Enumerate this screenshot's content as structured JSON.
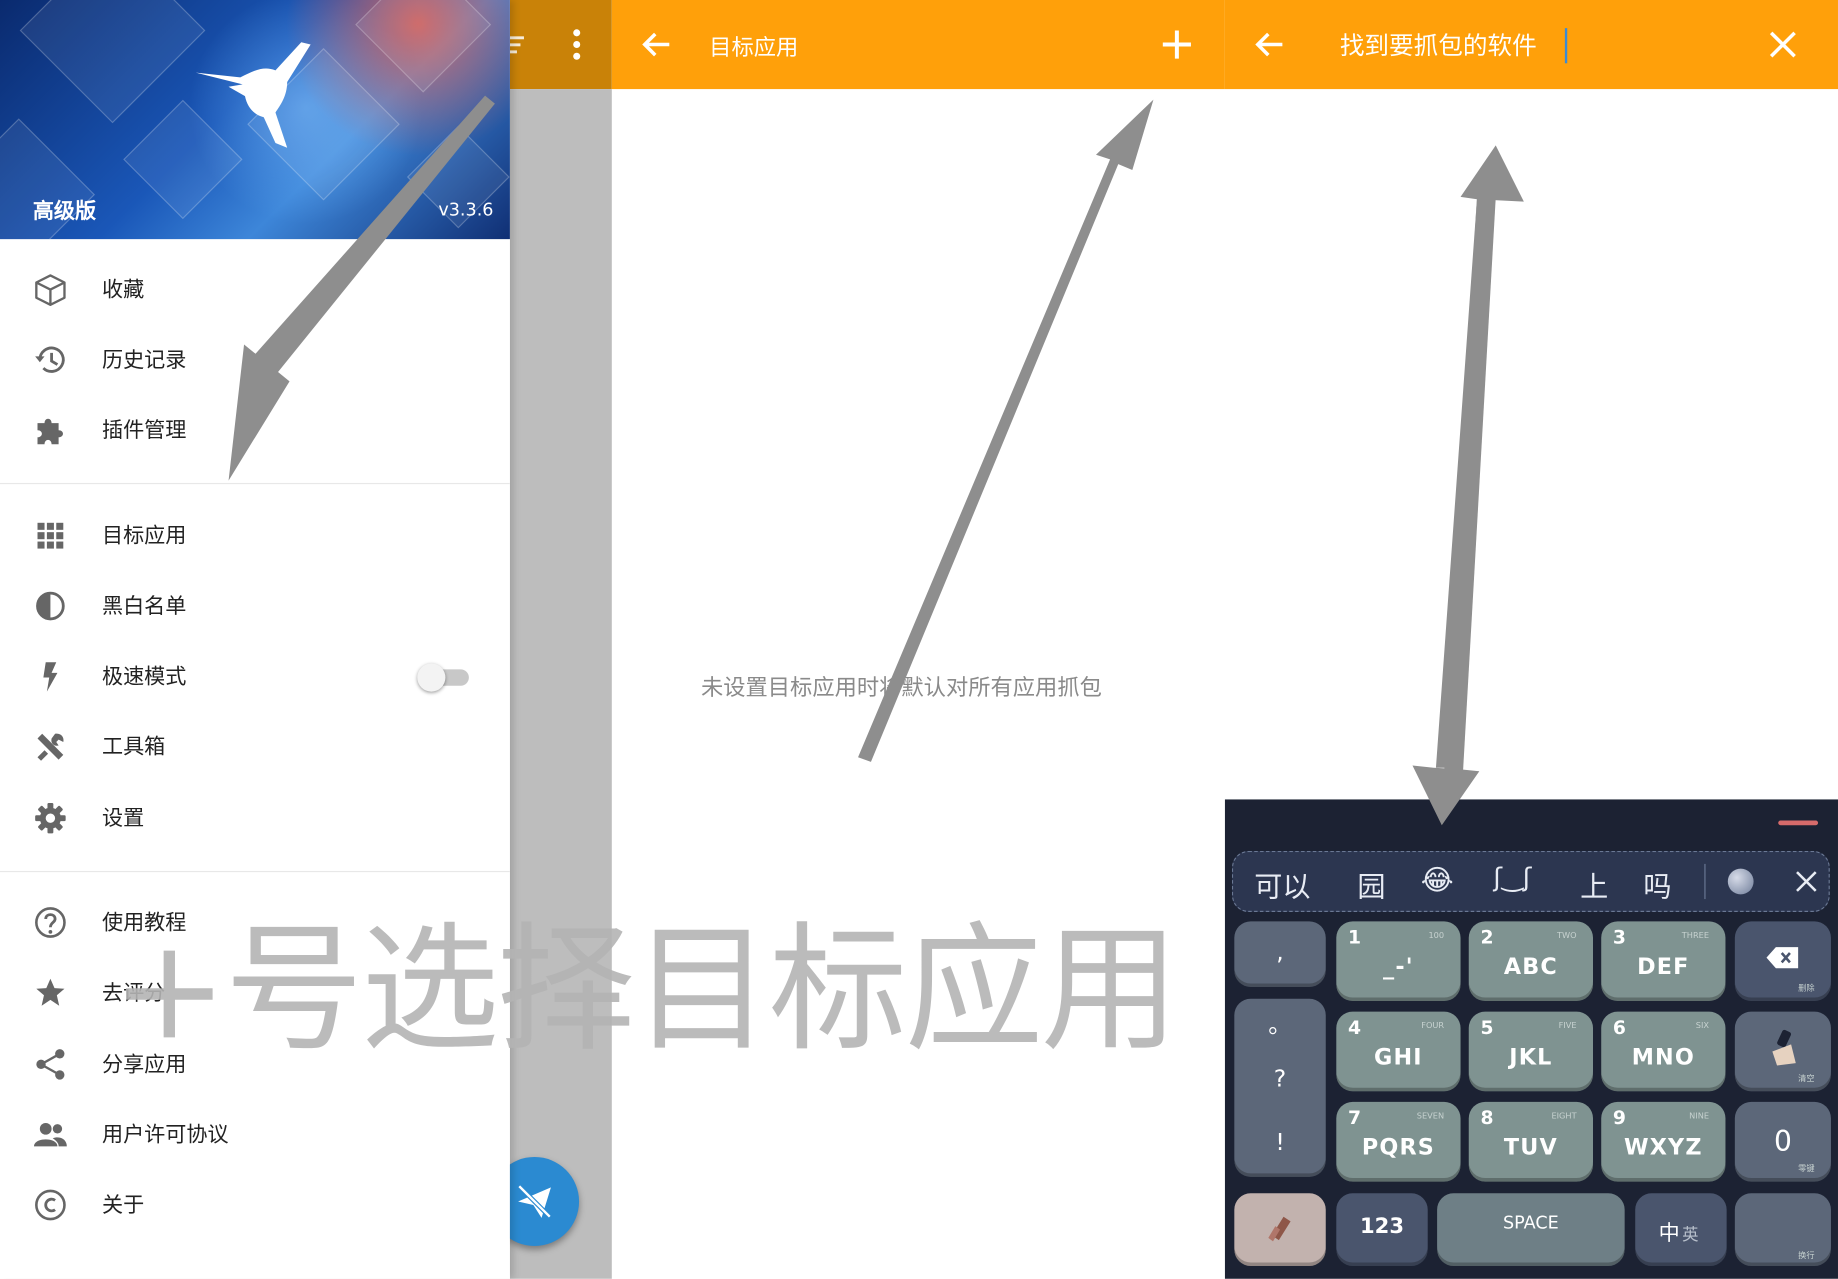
{
  "drawer": {
    "edition": "高级版",
    "version": "v3.3.6",
    "items": [
      {
        "label": "收藏",
        "icon": "cube-icon"
      },
      {
        "label": "历史记录",
        "icon": "history-icon"
      },
      {
        "label": "插件管理",
        "icon": "puzzle-icon"
      },
      {
        "label": "目标应用",
        "icon": "grid-icon"
      },
      {
        "label": "黑白名单",
        "icon": "half-circle-icon"
      },
      {
        "label": "极速模式",
        "icon": "lightning-icon"
      },
      {
        "label": "工具箱",
        "icon": "tools-icon"
      },
      {
        "label": "设置",
        "icon": "gear-icon"
      },
      {
        "label": "使用教程",
        "icon": "help-icon"
      },
      {
        "label": "去评分",
        "icon": "star-icon"
      },
      {
        "label": "分享应用",
        "icon": "share-icon"
      },
      {
        "label": "用户许可协议",
        "icon": "people-icon"
      },
      {
        "label": "关于",
        "icon": "copyright-icon"
      }
    ],
    "turbo_mode_enabled": false
  },
  "target_apps": {
    "title": "目标应用",
    "empty_message": "未设置目标应用时将默认对所有应用抓包"
  },
  "search": {
    "query": "找到要抓包的软件"
  },
  "keyboard": {
    "candidates": [
      "可以",
      "园",
      "😂",
      "ʃ‿ʃ",
      "上",
      "吗"
    ],
    "left_column": [
      ",",
      "。",
      "?",
      "!"
    ],
    "keys": [
      {
        "num": "1",
        "letters": "_-'",
        "sub": "100"
      },
      {
        "num": "2",
        "letters": "ABC",
        "sub": "TWO"
      },
      {
        "num": "3",
        "letters": "DEF",
        "sub": "THREE"
      },
      {
        "num": "4",
        "letters": "GHI",
        "sub": "FOUR"
      },
      {
        "num": "5",
        "letters": "JKL",
        "sub": "FIVE"
      },
      {
        "num": "6",
        "letters": "MNO",
        "sub": "SIX"
      },
      {
        "num": "7",
        "letters": "PQRS",
        "sub": "SEVEN"
      },
      {
        "num": "8",
        "letters": "TUV",
        "sub": "EIGHT"
      },
      {
        "num": "9",
        "letters": "WXYZ",
        "sub": "NINE"
      }
    ],
    "zero": "0",
    "num_switch": "123",
    "space": "SPACE",
    "lang": "中",
    "lang_alt": "英",
    "delete_hint": "删除",
    "clear_hint": "清空",
    "zero_hint": "零键",
    "enter_hint": "换行"
  },
  "overlay": {
    "caption": "+号选择目标应用",
    "arrow_color": "#8e8e8e"
  },
  "colors": {
    "app_bar": "#ffa00a",
    "accent_fab": "#2b8ad1"
  }
}
